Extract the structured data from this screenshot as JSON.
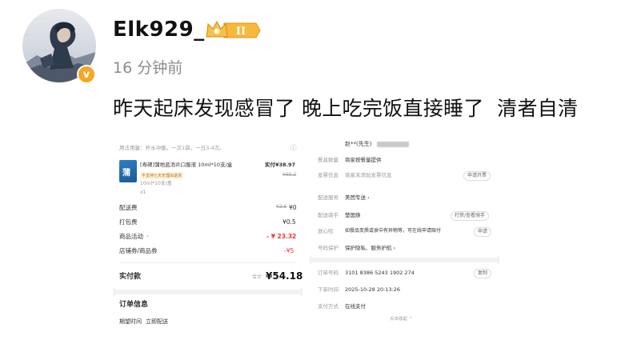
{
  "post": {
    "username": "Elk929_",
    "level_badge": "II",
    "verified_badge": "v",
    "timestamp": "16 分钟前",
    "text": "昨天起床发现感冒了 晚上吃完饭直接睡了  清者自清"
  },
  "icons": {
    "avatar": "avatar-illustration",
    "crown": "crown-level-badge-icon",
    "verified": "orange-v-verified-icon"
  },
  "colors": {
    "accent_orange": "#f6a623",
    "discount_red": "#e33333",
    "timestamp_gray": "#8c8c8c"
  },
  "order_left": {
    "usage": "用法用量：开水冲服。一次1袋，一日3-4次。",
    "product_name": "[寿碑]蒲地蓝消炎口服液 10ml*10支/盒",
    "price_label": "实付¥38.97",
    "orig_price": "¥65.2",
    "promo_tag": "不支持七天无理由退货",
    "spec": "10ml*10支/盒",
    "qty": "x1",
    "rows": [
      {
        "label": "配送费",
        "strike": "¥2.5",
        "value": "¥0"
      },
      {
        "label": "打包费",
        "strike": "",
        "value": "¥0.5"
      },
      {
        "label": "商品活动",
        "strike": "",
        "value": "- ¥ 23.32"
      },
      {
        "label": "店铺券/商品券",
        "strike": "",
        "value": "-¥5"
      }
    ],
    "total_label": "实付款",
    "total_prefix": "合计",
    "total_value": "¥54.18",
    "order_info_title": "订单信息",
    "expected_time_label": "期望时间",
    "expected_time_value": "立即配送"
  },
  "order_right": {
    "recipient": "赵**(先生)",
    "rows": [
      {
        "label": "餐具数量",
        "value": "商家按餐量提供",
        "button": ""
      },
      {
        "label": "发票信息",
        "value": "商家未添加发票信息",
        "button": "申请开票"
      },
      {
        "label": "配送服务",
        "value": "美团专送 ›",
        "button": ""
      },
      {
        "label": "配送骑手",
        "value": "楚国焕",
        "button": "打赏/查看骑手"
      },
      {
        "label": "放心吃",
        "value": "如餐品变质或食中有异物等，可在线申请赔付",
        "button": "申请"
      },
      {
        "label": "号码保护",
        "value": "保护隐私、服务护航 ›",
        "button": ""
      }
    ],
    "order_no_label": "订单号码",
    "order_no_value": "3101 8386 5243 1902 274",
    "copy_button": "复制",
    "order_time_label": "下单时间",
    "order_time_value": "2025-10-28 20:13:26",
    "pay_method_label": "支付方式",
    "pay_method_value": "在线支付",
    "collapse": "点击收起 ^"
  }
}
